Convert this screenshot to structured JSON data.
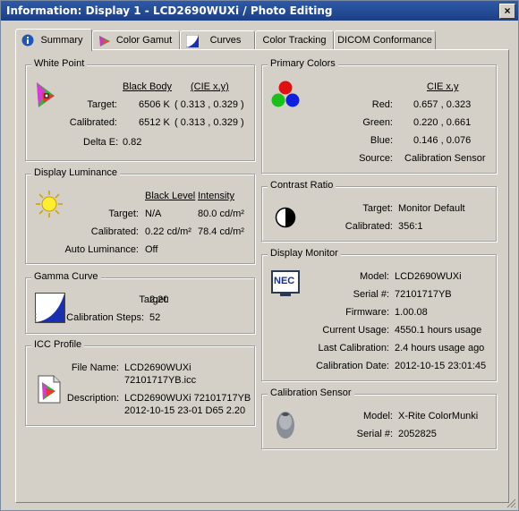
{
  "window": {
    "title": "Information: Display 1 - LCD2690WUXi / Photo Editing",
    "close_label": "×"
  },
  "tabs": [
    {
      "label": "Summary",
      "icon": "info-icon"
    },
    {
      "label": "Color Gamut",
      "icon": "color-gamut-icon"
    },
    {
      "label": "Curves",
      "icon": "curves-icon"
    },
    {
      "label": "Color Tracking"
    },
    {
      "label": "DICOM Conformance"
    }
  ],
  "white_point": {
    "legend": "White Point",
    "col1": "Black Body",
    "col2": "(CIE x,y)",
    "target_label": "Target:",
    "target_value": "6506 K",
    "target_cie": "( 0.313 , 0.329 )",
    "calibrated_label": "Calibrated:",
    "calibrated_value": "6512 K",
    "calibrated_cie": "( 0.313 , 0.329 )",
    "delta_label": "Delta E:",
    "delta_value": "0.82"
  },
  "luminance": {
    "legend": "Display Luminance",
    "col1": "Black Level",
    "col2": "Intensity",
    "target_label": "Target:",
    "target_black": "N/A",
    "target_intensity": "80.0 cd/m²",
    "calibrated_label": "Calibrated:",
    "calibrated_black": "0.22 cd/m²",
    "calibrated_intensity": "78.4 cd/m²",
    "auto_label": "Auto Luminance:",
    "auto_value": "Off"
  },
  "gamma": {
    "legend": "Gamma Curve",
    "target_label": "Target:",
    "target_value": "2.20",
    "steps_label": "Calibration Steps:",
    "steps_value": "52"
  },
  "icc": {
    "legend": "ICC Profile",
    "file_label": "File Name:",
    "file_line1": "LCD2690WUXi",
    "file_line2": "72101717YB.icc",
    "desc_label": "Description:",
    "desc_line1": "LCD2690WUXi 72101717YB",
    "desc_line2": "2012-10-15 23-01 D65 2.20"
  },
  "primaries": {
    "legend": "Primary Colors",
    "col": "CIE x,y",
    "red_label": "Red:",
    "red_value": "0.657 , 0.323",
    "green_label": "Green:",
    "green_value": "0.220 , 0.661",
    "blue_label": "Blue:",
    "blue_value": "0.146 , 0.076",
    "source_label": "Source:",
    "source_value": "Calibration Sensor"
  },
  "contrast": {
    "legend": "Contrast Ratio",
    "target_label": "Target:",
    "target_value": "Monitor Default",
    "calibrated_label": "Calibrated:",
    "calibrated_value": "356:1"
  },
  "monitor": {
    "legend": "Display Monitor",
    "logo": "NEC",
    "model_label": "Model:",
    "model_value": "LCD2690WUXi",
    "serial_label": "Serial #:",
    "serial_value": "72101717YB",
    "firmware_label": "Firmware:",
    "firmware_value": "1.00.08",
    "usage_label": "Current Usage:",
    "usage_value": "4550.1 hours usage",
    "last_label": "Last Calibration:",
    "last_value": "2.4 hours usage ago",
    "date_label": "Calibration Date:",
    "date_value": "2012-10-15 23:01:45"
  },
  "sensor": {
    "legend": "Calibration Sensor",
    "model_label": "Model:",
    "model_value": "X-Rite ColorMunki",
    "serial_label": "Serial #:",
    "serial_value": "2052825"
  }
}
